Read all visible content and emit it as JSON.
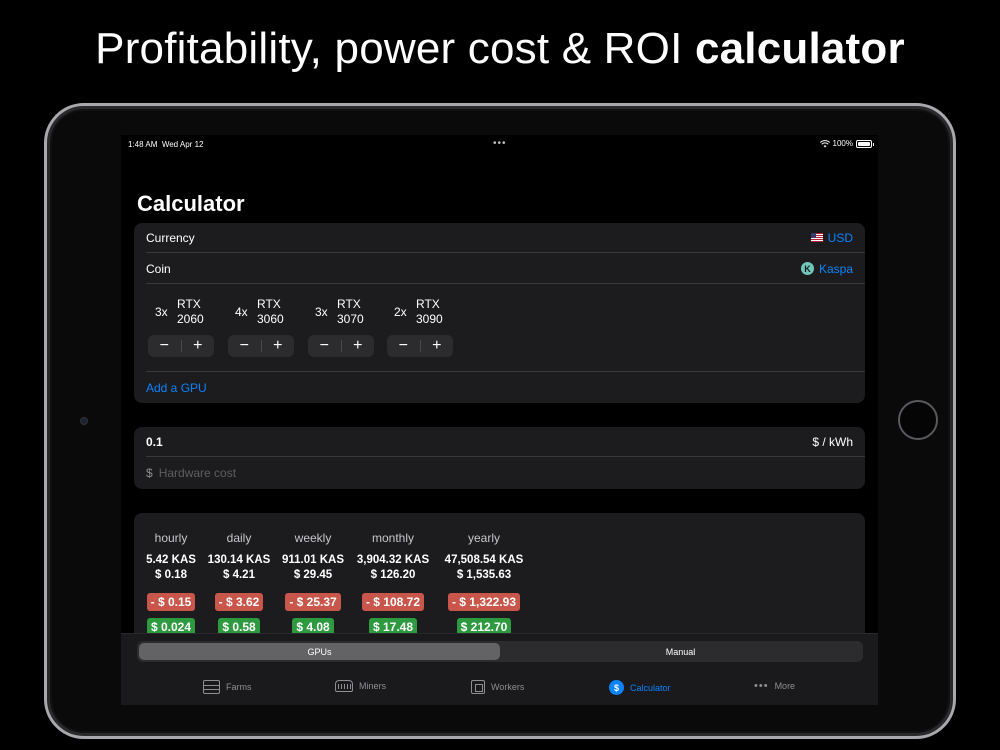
{
  "headline": {
    "regular": "Profitability, power cost & ROI",
    "bold": "calculator"
  },
  "status_bar": {
    "time": "1:48 AM",
    "date": "Wed Apr 12",
    "more": "•••",
    "battery": "100%"
  },
  "page_title": "Calculator",
  "settings": {
    "currency_label": "Currency",
    "currency_value": "USD",
    "coin_label": "Coin",
    "coin_value": "Kaspa"
  },
  "gpus": [
    {
      "count": "3x",
      "line1": "RTX",
      "line2": "2060"
    },
    {
      "count": "4x",
      "line1": "RTX",
      "line2": "3060"
    },
    {
      "count": "3x",
      "line1": "RTX",
      "line2": "3070"
    },
    {
      "count": "2x",
      "line1": "RTX",
      "line2": "3090"
    }
  ],
  "stepper": {
    "minus": "−",
    "plus": "+"
  },
  "add_gpu": "Add a GPU",
  "power": {
    "price": "0.1",
    "unit": "$ / kWh",
    "currency_symbol": "$",
    "hardware_placeholder": "Hardware cost"
  },
  "results": [
    {
      "period": "hourly",
      "coin": "5.42 KAS",
      "usd": "$ 0.18",
      "cost": "- $ 0.15",
      "profit": "$ 0.024"
    },
    {
      "period": "daily",
      "coin": "130.14 KAS",
      "usd": "$ 4.21",
      "cost": "- $ 3.62",
      "profit": "$ 0.58"
    },
    {
      "period": "weekly",
      "coin": "911.01 KAS",
      "usd": "$ 29.45",
      "cost": "- $ 25.37",
      "profit": "$ 4.08"
    },
    {
      "period": "monthly",
      "coin": "3,904.32 KAS",
      "usd": "$ 126.20",
      "cost": "- $ 108.72",
      "profit": "$ 17.48"
    },
    {
      "period": "yearly",
      "coin": "47,508.54 KAS",
      "usd": "$ 1,535.63",
      "cost": "- $ 1,322.93",
      "profit": "$ 212.70"
    }
  ],
  "segment": {
    "gpus": "GPUs",
    "manual": "Manual"
  },
  "tabs": {
    "farms": "Farms",
    "miners": "Miners",
    "workers": "Workers",
    "calculator": "Calculator",
    "more": "More"
  },
  "colors": {
    "accent": "#0a84ff",
    "negative": "#c9564b",
    "positive": "#2e9a3f",
    "card": "#1c1c1e"
  },
  "icons": {
    "calculator_tab": "$",
    "coin_logo": "K",
    "more_tab": "•••"
  }
}
